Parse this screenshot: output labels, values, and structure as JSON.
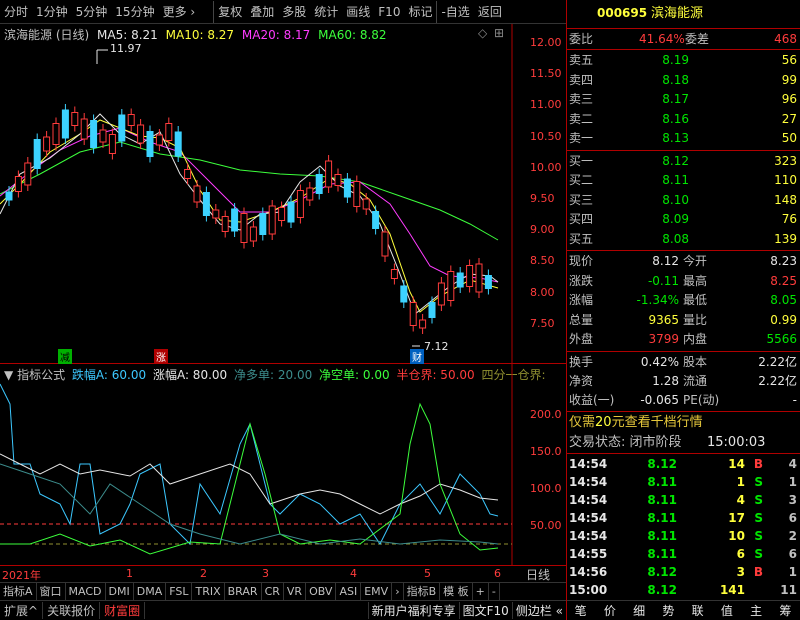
{
  "toolbar": {
    "items": [
      "分时",
      "1分钟",
      "5分钟",
      "15分钟",
      "更多 ›",
      "复权",
      "叠加",
      "多股",
      "统计",
      "画线",
      "F10",
      "标记",
      "-自选",
      "返回"
    ]
  },
  "stock": {
    "code": "000695",
    "name": "滨海能源"
  },
  "main_chart": {
    "title": "滨海能源 (日线)",
    "ma5": "MA5: 8.21",
    "ma10": "MA10: 8.27",
    "ma20": "MA20: 8.17",
    "ma60": "MA60: 8.82",
    "high_label": "11.97",
    "low_label": "7.12",
    "yticks": [
      "12.00",
      "11.50",
      "11.00",
      "10.50",
      "10.00",
      "9.50",
      "9.00",
      "8.50",
      "8.00",
      "7.50"
    ],
    "markers": [
      "减",
      "涨",
      "财"
    ]
  },
  "indicator": {
    "name": "指标公式",
    "die": "跌幅A: 60.00",
    "zhang": "涨幅A: 80.00",
    "jingduo": "净多单: 20.00",
    "jingkong": "净空单: 0.00",
    "banchang": "半仓界: 50.00",
    "sifen": "四分一仓界:",
    "yticks": [
      "200.0",
      "150.0",
      "100.0",
      "50.00"
    ]
  },
  "xaxis": {
    "labels": [
      "2021年",
      "1",
      "2",
      "3",
      "4",
      "5",
      "6"
    ],
    "period": "日线"
  },
  "bottom_tabs": [
    "指标A",
    "窗口",
    "MACD",
    "DMI",
    "DMA",
    "FSL",
    "TRIX",
    "BRAR",
    "CR",
    "VR",
    "OBV",
    "ASI",
    "EMV",
    "›",
    "指标B",
    "模 板",
    "+",
    "-"
  ],
  "footer": {
    "items": [
      "扩展^",
      "关联报价",
      "财富圈"
    ],
    "right": [
      "新用户福利专享",
      "图文F10",
      "侧边栏 «"
    ],
    "side": [
      "笔",
      "价",
      "细",
      "势",
      "联",
      "值",
      "主",
      "筹"
    ]
  },
  "weibi": {
    "label": "委比",
    "value": "41.64%",
    "label2": "委差",
    "value2": "468"
  },
  "asks": [
    {
      "label": "卖五",
      "price": "8.19",
      "vol": "56"
    },
    {
      "label": "卖四",
      "price": "8.18",
      "vol": "99"
    },
    {
      "label": "卖三",
      "price": "8.17",
      "vol": "96"
    },
    {
      "label": "卖二",
      "price": "8.16",
      "vol": "27"
    },
    {
      "label": "卖一",
      "price": "8.13",
      "vol": "50"
    }
  ],
  "bids": [
    {
      "label": "买一",
      "price": "8.12",
      "vol": "323"
    },
    {
      "label": "买二",
      "price": "8.11",
      "vol": "110"
    },
    {
      "label": "买三",
      "price": "8.10",
      "vol": "148"
    },
    {
      "label": "买四",
      "price": "8.09",
      "vol": "76"
    },
    {
      "label": "买五",
      "price": "8.08",
      "vol": "139"
    }
  ],
  "quote": [
    {
      "l1": "现价",
      "v1": "8.12",
      "l2": "今开",
      "v2": "8.23"
    },
    {
      "l1": "涨跌",
      "v1": "-0.11",
      "l2": "最高",
      "v2": "8.25"
    },
    {
      "l1": "涨幅",
      "v1": "-1.34%",
      "l2": "最低",
      "v2": "8.05"
    },
    {
      "l1": "总量",
      "v1": "9365",
      "l2": "量比",
      "v2": "0.99"
    },
    {
      "l1": "外盘",
      "v1": "3799",
      "l2": "内盘",
      "v2": "5566"
    }
  ],
  "stats": [
    {
      "l1": "换手",
      "v1": "0.42%",
      "l2": "股本",
      "v2": "2.22亿"
    },
    {
      "l1": "净资",
      "v1": "1.28",
      "l2": "流通",
      "v2": "2.22亿"
    },
    {
      "l1": "收益(一)",
      "v1": "-0.065",
      "l2": "PE(动)",
      "v2": "-"
    }
  ],
  "promo": {
    "text1": "仅需",
    "num": "20",
    "text2": "元查看千档行情"
  },
  "status": {
    "label": "交易状态: 闭市阶段",
    "time": "15:00:03"
  },
  "trades": [
    {
      "t": "14:54",
      "p": "8.12",
      "v": "14",
      "d": "B",
      "n": "4"
    },
    {
      "t": "14:54",
      "p": "8.11",
      "v": "1",
      "d": "S",
      "n": "1"
    },
    {
      "t": "14:54",
      "p": "8.11",
      "v": "4",
      "d": "S",
      "n": "3"
    },
    {
      "t": "14:54",
      "p": "8.11",
      "v": "17",
      "d": "S",
      "n": "6"
    },
    {
      "t": "14:54",
      "p": "8.11",
      "v": "10",
      "d": "S",
      "n": "2"
    },
    {
      "t": "14:55",
      "p": "8.11",
      "v": "6",
      "d": "S",
      "n": "6"
    },
    {
      "t": "14:56",
      "p": "8.12",
      "v": "3",
      "d": "B",
      "n": "1"
    },
    {
      "t": "15:00",
      "p": "8.12",
      "v": "141",
      "d": "",
      "n": "11"
    }
  ]
}
